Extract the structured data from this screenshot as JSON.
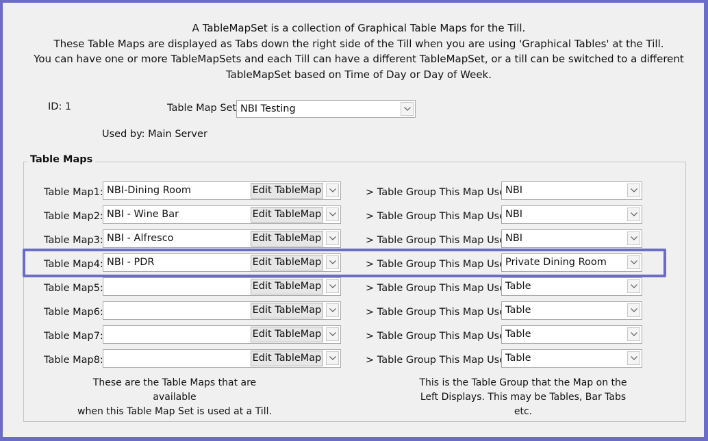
{
  "intro_lines": [
    "A TableMapSet is a collection of Graphical Table Maps for the Till.",
    "These Table Maps are displayed as Tabs down the right side of the Till when you are using 'Graphical Tables' at the Till.",
    "You can have one or more TableMapSets and each Till can have a different TableMapSet, or a till can be switched to a different",
    "TableMapSet based on Time of Day or Day of Week."
  ],
  "id_label": "ID: 1",
  "table_map_set": {
    "label": "Table Map Set:",
    "value": "NBI Testing"
  },
  "used_by": "Used by: Main Server",
  "group_title": "Table Maps",
  "edit_label": "Edit TableMap",
  "group_uses_label": "> Table Group This Map Uses:",
  "rows": [
    {
      "label": "Table Map1:",
      "map": "NBI-Dining Room",
      "group": "NBI"
    },
    {
      "label": "Table Map2:",
      "map": "NBI - Wine Bar",
      "group": "NBI"
    },
    {
      "label": "Table Map3:",
      "map": "NBI - Alfresco",
      "group": "NBI"
    },
    {
      "label": "Table Map4:",
      "map": "NBI - PDR",
      "group": "Private Dining Room"
    },
    {
      "label": "Table Map5:",
      "map": "",
      "group": "Table"
    },
    {
      "label": "Table Map6:",
      "map": "",
      "group": "Table"
    },
    {
      "label": "Table Map7:",
      "map": "",
      "group": "Table"
    },
    {
      "label": "Table Map8:",
      "map": "",
      "group": "Table"
    }
  ],
  "left_note": [
    "These are the Table Maps that are available",
    "when this Table Map Set is used at a Till."
  ],
  "right_note": [
    "This is the Table Group that the Map on the",
    "Left Displays. This may be Tables, Bar Tabs etc."
  ],
  "colors": {
    "frame": "#6b6bc8",
    "highlight": "#6b6bc8",
    "panel": "#f0f0f0"
  }
}
